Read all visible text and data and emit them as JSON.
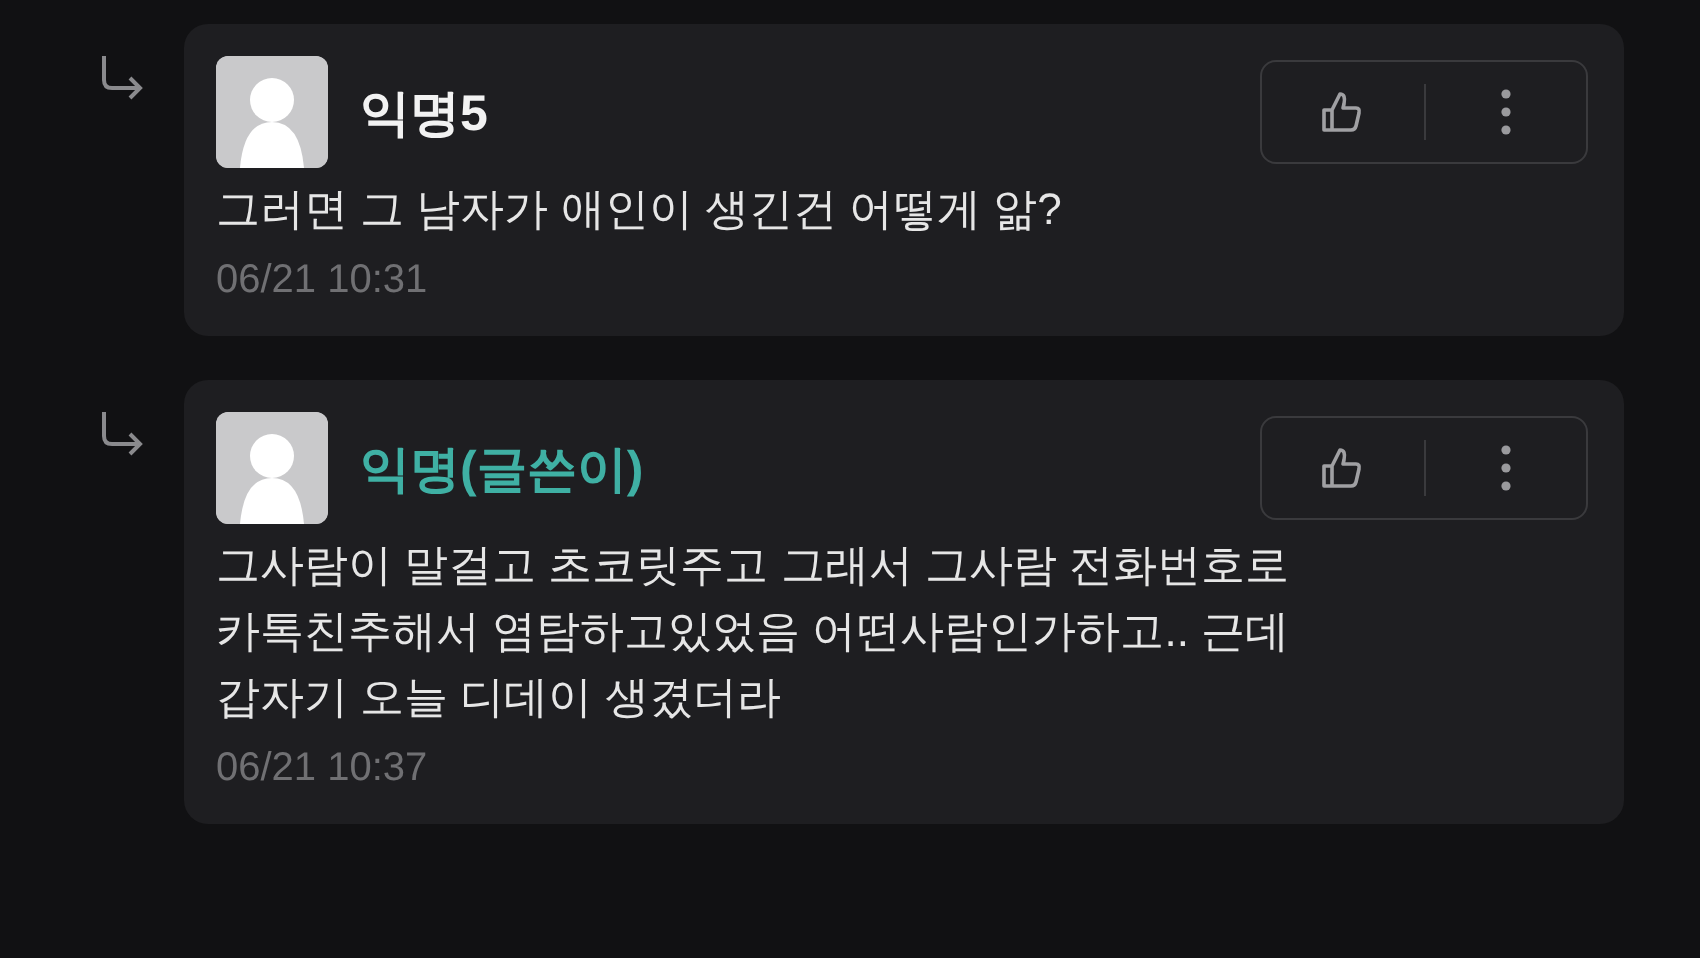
{
  "comments": [
    {
      "author": "익명5",
      "is_writer": false,
      "text": "그러면 그 남자가 애인이 생긴건 어떻게 앎?",
      "time": "06/21 10:31"
    },
    {
      "author": "익명(글쓴이)",
      "is_writer": true,
      "text": "그사람이 말걸고 초코릿주고 그래서 그사람 전화번호로\n카톡친추해서 염탐하고있었음 어떤사람인가하고.. 근데\n갑자기 오늘 디데이 생겼더라",
      "time": "06/21 10:37"
    }
  ]
}
